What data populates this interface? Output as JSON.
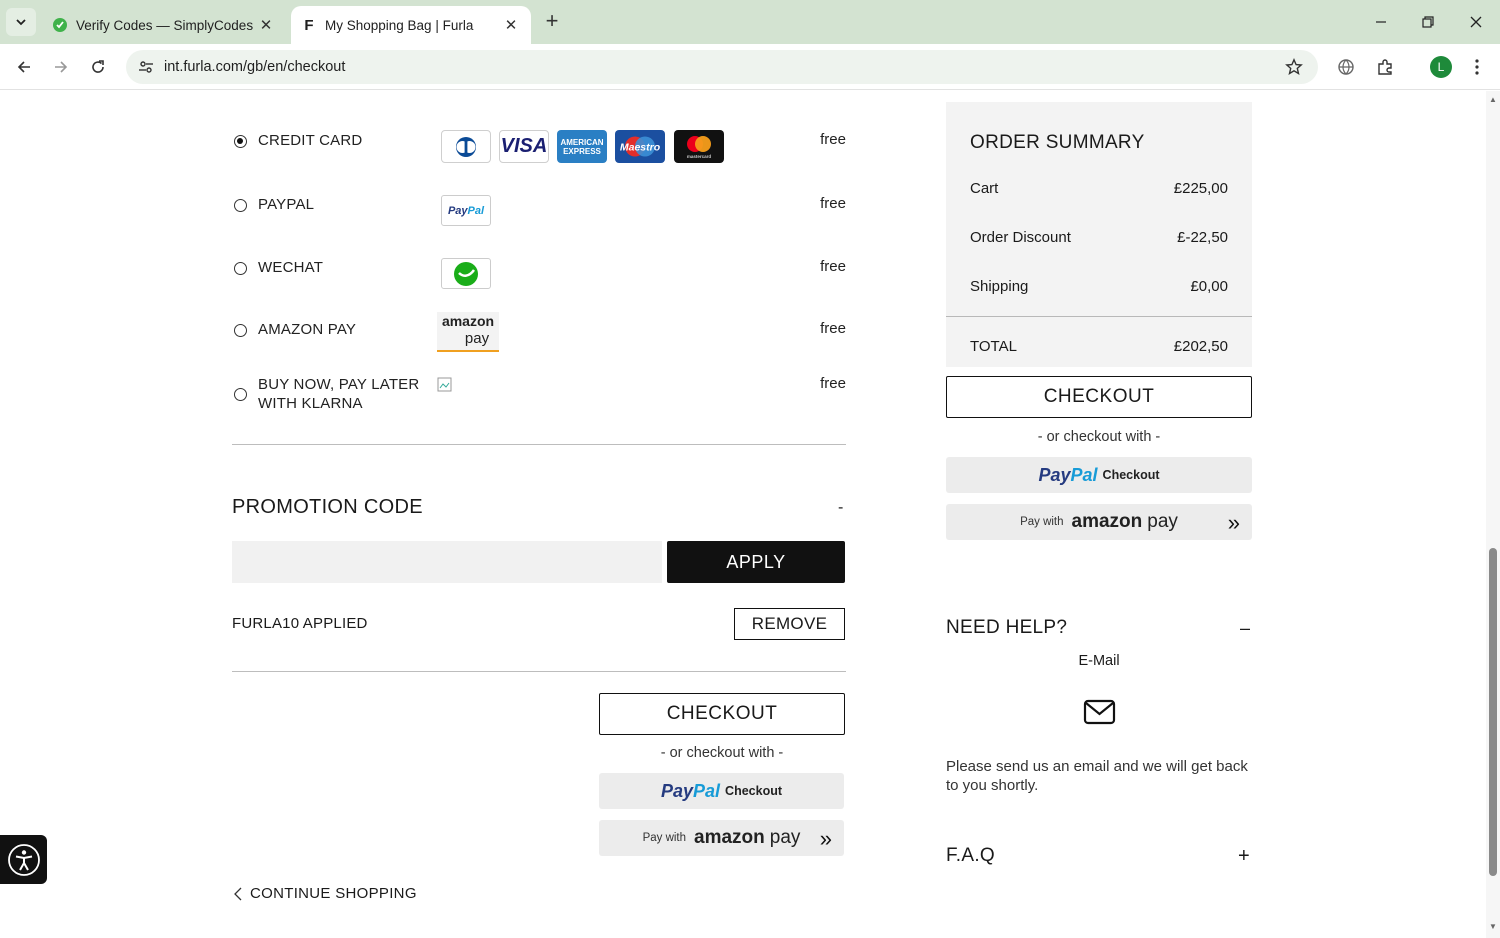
{
  "browser": {
    "tabs": [
      {
        "title": "Verify Codes — SimplyCodes",
        "active": false,
        "favicon": "simplycodes-icon"
      },
      {
        "title": "My Shopping Bag | Furla",
        "active": true,
        "favicon": "furla-f-icon",
        "favicon_text": "F"
      }
    ],
    "url": "int.furla.com/gb/en/checkout",
    "profile_initial": "L"
  },
  "payment_methods": [
    {
      "label": "CREDIT CARD",
      "price": "free",
      "selected": true,
      "logos": [
        "diners-icon",
        "visa-icon",
        "amex-icon",
        "maestro-icon",
        "mastercard-icon"
      ]
    },
    {
      "label": "PAYPAL",
      "price": "free",
      "selected": false,
      "logos": [
        "paypal-icon"
      ]
    },
    {
      "label": "WECHAT",
      "price": "free",
      "selected": false,
      "logos": [
        "wechat-icon"
      ]
    },
    {
      "label": "AMAZON PAY",
      "price": "free",
      "selected": false,
      "logos": [
        "amazon-pay-icon"
      ]
    },
    {
      "label": "BUY NOW, PAY LATER WITH KLARNA",
      "price": "free",
      "selected": false,
      "logos": [
        "broken-image-icon"
      ]
    }
  ],
  "card_logo_text": {
    "visa": "VISA",
    "amex_top": "AMERICAN",
    "amex_bottom": "EXPRESS",
    "maestro": "Maestro",
    "mastercard": "mastercard",
    "paypal_p": "Pay",
    "paypal_pal": "Pal",
    "amazon": "amazon",
    "pay": "pay"
  },
  "promotion": {
    "title": "PROMOTION CODE",
    "toggle": "-",
    "input_value": "",
    "apply_label": "APPLY",
    "applied_text": "FURLA10 APPLIED",
    "remove_label": "REMOVE"
  },
  "checkout": {
    "button_label": "CHECKOUT",
    "or_with": "- or checkout with -",
    "paypal_p": "Pay",
    "paypal_pal": "Pal",
    "paypal_checkout": "Checkout",
    "amazon_with": "Pay with",
    "amazon_word": "amazon",
    "amazon_pay": "pay",
    "amazon_arrow": "»"
  },
  "continue_shopping": "CONTINUE SHOPPING",
  "summary": {
    "title": "ORDER SUMMARY",
    "rows": [
      {
        "label": "Cart",
        "value": "£225,00"
      },
      {
        "label": "Order Discount",
        "value": "£-22,50"
      },
      {
        "label": "Shipping",
        "value": "£0,00"
      }
    ],
    "total_label": "TOTAL",
    "total_value": "£202,50"
  },
  "help": {
    "title": "NEED HELP?",
    "toggle": "–",
    "email_label": "E-Mail",
    "text": "Please send us an email and we will get back to you shortly.",
    "faq_title": "F.A.Q",
    "faq_toggle": "+"
  }
}
